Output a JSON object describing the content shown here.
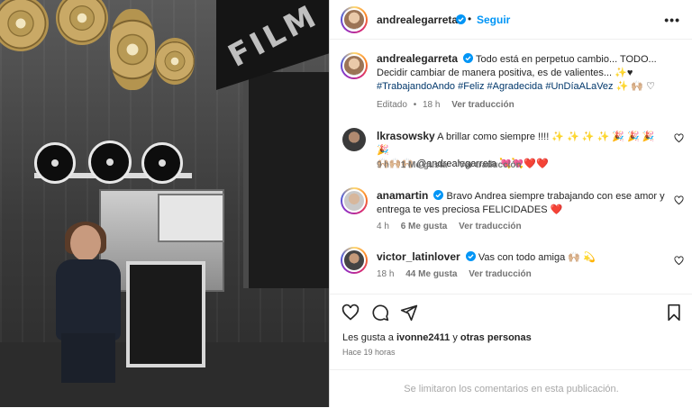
{
  "post": {
    "author": "andrealegarreta",
    "follow_label": "Seguir",
    "more_icon": "more-horizontal-icon",
    "caption": {
      "text_line1": "Todo está en perpetuo cambio... TODO...",
      "text_line2": "Decidir cambiar de manera positiva, es de valientes... ✨♥",
      "hashtags": "#TrabajandoAndo #Feliz #Agradecida #UnDíaALaVez",
      "emoji_tail": "✨ 🙌🏼 ♡",
      "edited_label": "Editado",
      "age": "18 h",
      "translate_label": "Ver traducción"
    },
    "comments": [
      {
        "username": "lkrasowsky",
        "verified": false,
        "text_line1": "A brillar como siempre !!!! ✨ ✨ ✨ ✨ 🎉 🎉 🎉 🎉",
        "text_line2": "🙌🏼🙌🏼🙌🏼 @andrealegarreta 💘💘❤️❤️",
        "age": "9 h",
        "likes": "1 Me gusta",
        "translate_label": "Ver traducción"
      },
      {
        "username": "anamartin",
        "verified": true,
        "text_line1": "Bravo Andrea siempre trabajando con ese amor y",
        "text_line2": "entrega te ves preciosa FELICIDADES ❤️",
        "age": "4 h",
        "likes": "6 Me gusta",
        "translate_label": "Ver traducción"
      },
      {
        "username": "victor_latinlover",
        "verified": true,
        "text_line1": "Vas con todo amiga 🙌🏼 💫",
        "text_line2": "",
        "age": "18 h",
        "likes": "44 Me gusta",
        "translate_label": "Ver traducción"
      }
    ],
    "likes_prefix": "Les gusta a",
    "likes_user": "ivonne2411",
    "likes_join": "y",
    "likes_others": "otras personas",
    "time_ago": "Hace 19 horas",
    "comments_limited": "Se limitaron los comentarios en esta publicación.",
    "photo_sign_text": "FILM"
  },
  "colors": {
    "link_blue": "#0095f6",
    "hashtag": "#00376b",
    "muted": "#737373",
    "heart_red": "#ff3040"
  }
}
